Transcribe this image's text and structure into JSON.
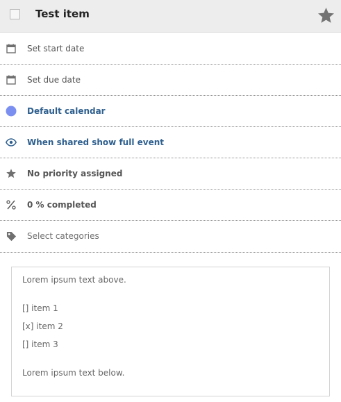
{
  "header": {
    "title": "Test item"
  },
  "rows": [
    {
      "label": "Set start date",
      "icon": "calendar-icon"
    },
    {
      "label": "Set due date",
      "icon": "calendar-icon"
    },
    {
      "label": "Default calendar",
      "icon": "calendar-color-dot-icon"
    },
    {
      "label": "When shared show full event",
      "icon": "eye-icon"
    },
    {
      "label": "No priority assigned",
      "icon": "star-icon"
    },
    {
      "label": "0 % completed",
      "icon": "percent-icon"
    },
    {
      "label": "Select categories",
      "icon": "tag-icon"
    }
  ],
  "description": {
    "lines": [
      "Lorem ipsum text above.",
      "[] item 1",
      "[x] item 2",
      "[] item 3",
      "Lorem ipsum text below."
    ]
  },
  "colors": {
    "header_bg": "#ededed",
    "accent_blue": "#2e5f8e",
    "calendar_dot": "#7b8ff0",
    "icon_gray": "#6f6f6f"
  }
}
